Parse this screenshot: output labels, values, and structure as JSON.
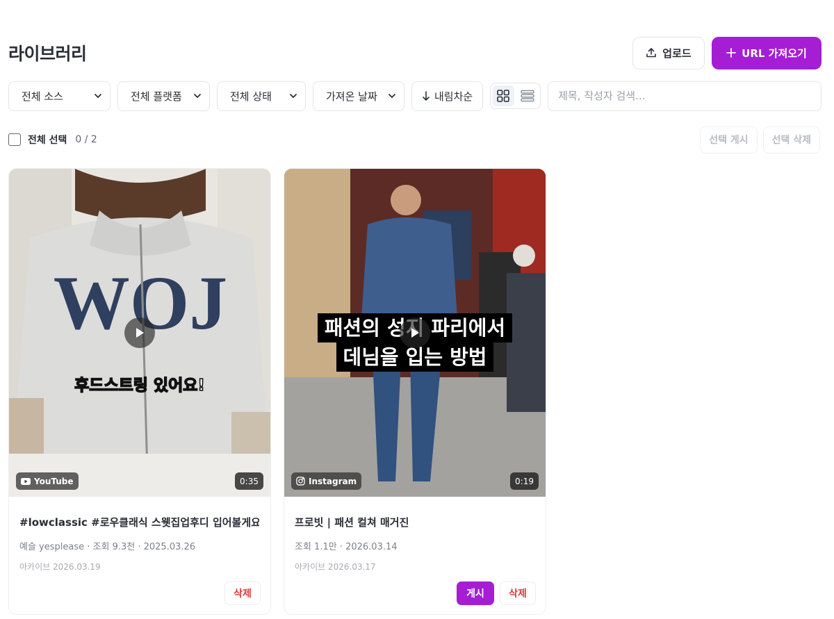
{
  "page": {
    "title": "라이브러리"
  },
  "header": {
    "upload_label": "업로드",
    "import_label": "URL 가져오기"
  },
  "filters": {
    "source": "전체 소스",
    "platform": "전체 플랫폼",
    "status": "전체 상태",
    "date": "가져온 날짜",
    "sort": "내림차순",
    "search_placeholder": "제목, 작성자 검색..."
  },
  "selection": {
    "label": "전체 선택",
    "count": "0 / 2",
    "post_label": "선택 게시",
    "delete_label": "선택 삭제"
  },
  "cards": [
    {
      "platform": "YouTube",
      "duration": "0:35",
      "caption": "후드스트링 있어요!",
      "title": "#lowclassic #로우클래식 스웻집업후디 입어볼게요 #",
      "meta": "예슬 yesplease · 조회 9.3천 · 2025.03.26",
      "archive": "아카이브 2026.03.19",
      "delete_label": "삭제"
    },
    {
      "platform": "Instagram",
      "duration": "0:19",
      "caption_line1": "패션의 성지 파리에서",
      "caption_line2": "데님을 입는 방법",
      "title": "프로빗 | 패션 컬쳐 매거진",
      "meta": "조회 1.1만 · 2026.03.14",
      "archive": "아카이브 2026.03.17",
      "post_label": "게시",
      "delete_label": "삭제"
    }
  ],
  "colors": {
    "accent": "#a51ed4",
    "danger": "#e03a3a"
  }
}
